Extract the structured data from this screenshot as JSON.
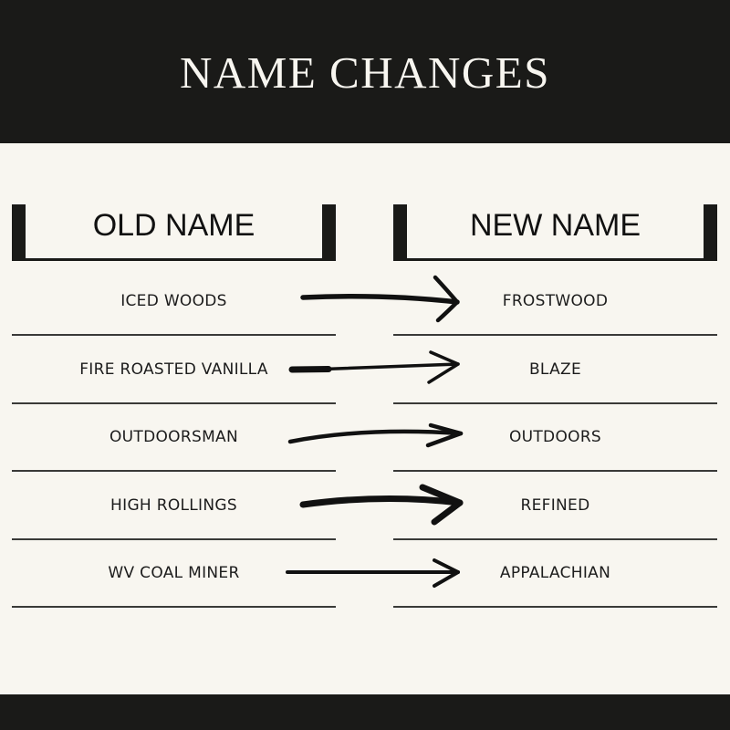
{
  "title": "NAME CHANGES",
  "columns": {
    "old": "OLD NAME",
    "new": "NEW NAME"
  },
  "rows": [
    {
      "old": "ICED WOODS",
      "new": "FROSTWOOD",
      "arrow_icon": "hand-drawn-arrow-right"
    },
    {
      "old": "FIRE ROASTED VANILLA",
      "new": "BLAZE",
      "arrow_icon": "hand-drawn-arrow-right"
    },
    {
      "old": "OUTDOORSMAN",
      "new": "OUTDOORS",
      "arrow_icon": "hand-drawn-arrow-right"
    },
    {
      "old": "HIGH ROLLINGS",
      "new": "REFINED",
      "arrow_icon": "hand-drawn-arrow-right"
    },
    {
      "old": "WV COAL MINER",
      "new": "APPALACHIAN",
      "arrow_icon": "hand-drawn-arrow-right"
    }
  ],
  "colors": {
    "dark": "#1a1a18",
    "background": "#f8f6f0"
  }
}
